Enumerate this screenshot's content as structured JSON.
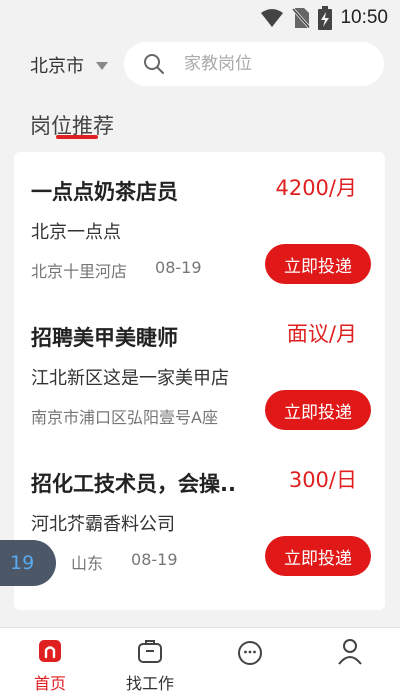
{
  "status": {
    "time": "10:50"
  },
  "search": {
    "city": "北京市",
    "placeholder": "家教岗位"
  },
  "section": {
    "title": "岗位推荐"
  },
  "jobs": [
    {
      "title": "一点点奶茶店员",
      "salary": "4200/月",
      "company": "北京一点点",
      "location": "北京十里河店",
      "date": "08-19",
      "apply_label": "立即投递"
    },
    {
      "title": "招聘美甲美睫师",
      "salary": "面议/月",
      "company": "江北新区这是一家美甲店",
      "location": "南京市浦口区弘阳壹号A座",
      "date": "",
      "apply_label": "立即投递"
    },
    {
      "title": "招化工技术员，会操..",
      "salary": "300/日",
      "company": "河北芥霸香料公司",
      "location": "山东",
      "date": "08-19",
      "apply_label": "立即投递"
    }
  ],
  "floating_badge": {
    "text": "19"
  },
  "tabs": [
    {
      "label": "首页",
      "icon": "home-icon",
      "active": true
    },
    {
      "label": "找工作",
      "icon": "briefcase-icon",
      "active": false
    },
    {
      "label": "",
      "icon": "message-icon",
      "active": false
    },
    {
      "label": "",
      "icon": "user-icon",
      "active": false
    }
  ],
  "colors": {
    "accent": "#e02020",
    "background": "#f2f2f2",
    "badge": "#3d4a5c"
  }
}
